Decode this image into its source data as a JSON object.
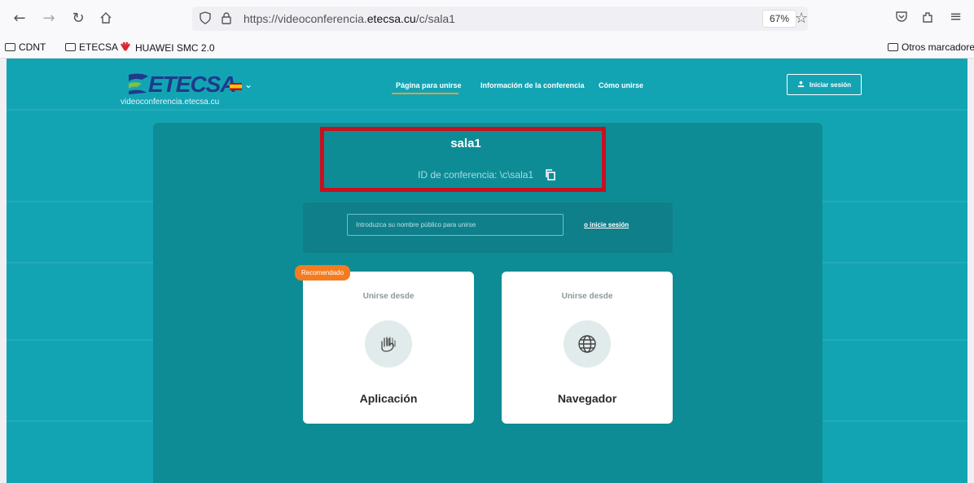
{
  "browser": {
    "url_prefix": "https://videoconferencia.",
    "url_domain": "etecsa.cu",
    "url_path": "/c/sala1",
    "zoom": "67%",
    "bookmarks": [
      "CDNT",
      "ETECSA",
      "HUAWEI SMC 2.0"
    ],
    "other_bookmarks": "Otros marcadores"
  },
  "header": {
    "logo_text": "ETECSA",
    "logo_subtext": "videoconferencia.etecsa.cu",
    "nav": [
      "Página para unirse",
      "Información de la conferencia",
      "Cómo unirse"
    ],
    "login_label": "Iniciar sesión"
  },
  "conference": {
    "title": "sala1",
    "id_text": "ID de conferencia: \\c\\sala1"
  },
  "join": {
    "name_placeholder": "Introduzca su nombre público para unirse",
    "signin_link": "o inicie sesión"
  },
  "cards": [
    {
      "subtitle": "Unirse desde",
      "title": "Aplicación",
      "icon": "hands-icon"
    },
    {
      "subtitle": "Unirse desde",
      "title": "Navegador",
      "icon": "globe-icon"
    }
  ],
  "recommended_badge": "Recomendado",
  "colors": {
    "page_bg": "#13a4b4",
    "panel_bg": "#0e8c96",
    "highlight": "#c8101e",
    "badge": "#f47c20"
  }
}
